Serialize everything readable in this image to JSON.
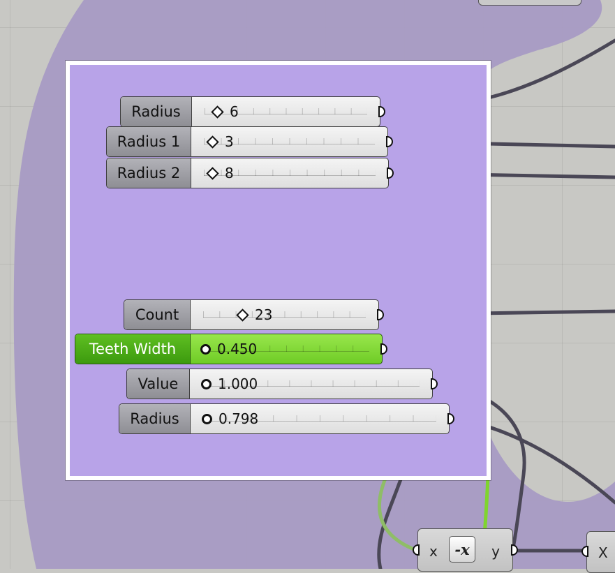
{
  "sliders": [
    {
      "label": "Radius",
      "value": "6",
      "marker": "diamond"
    },
    {
      "label": "Radius 1",
      "value": "3",
      "marker": "diamond"
    },
    {
      "label": "Radius 2",
      "value": "8",
      "marker": "diamond"
    },
    {
      "label": "Count",
      "value": "23",
      "marker": "diamond"
    },
    {
      "label": "Teeth Width",
      "value": "0.450",
      "marker": "circle",
      "selected": true
    },
    {
      "label": "Value",
      "value": "1.000",
      "marker": "circle"
    },
    {
      "label": "Radius",
      "value": "0.798",
      "marker": "circle"
    }
  ],
  "negative_component": {
    "input": "x",
    "output": "y",
    "icon": "negative-x-icon",
    "icon_glyph": "-x"
  },
  "next_component": {
    "input": "X"
  },
  "colors": {
    "canvas": "#c8c8c4",
    "group_fill": "#b8a3e8",
    "group_frame": "#ffffff",
    "outer_group": "#a89bc4",
    "selected_slider": "#7ed63a",
    "wire": "#4a4756",
    "selected_wire": "#7fd52e"
  }
}
